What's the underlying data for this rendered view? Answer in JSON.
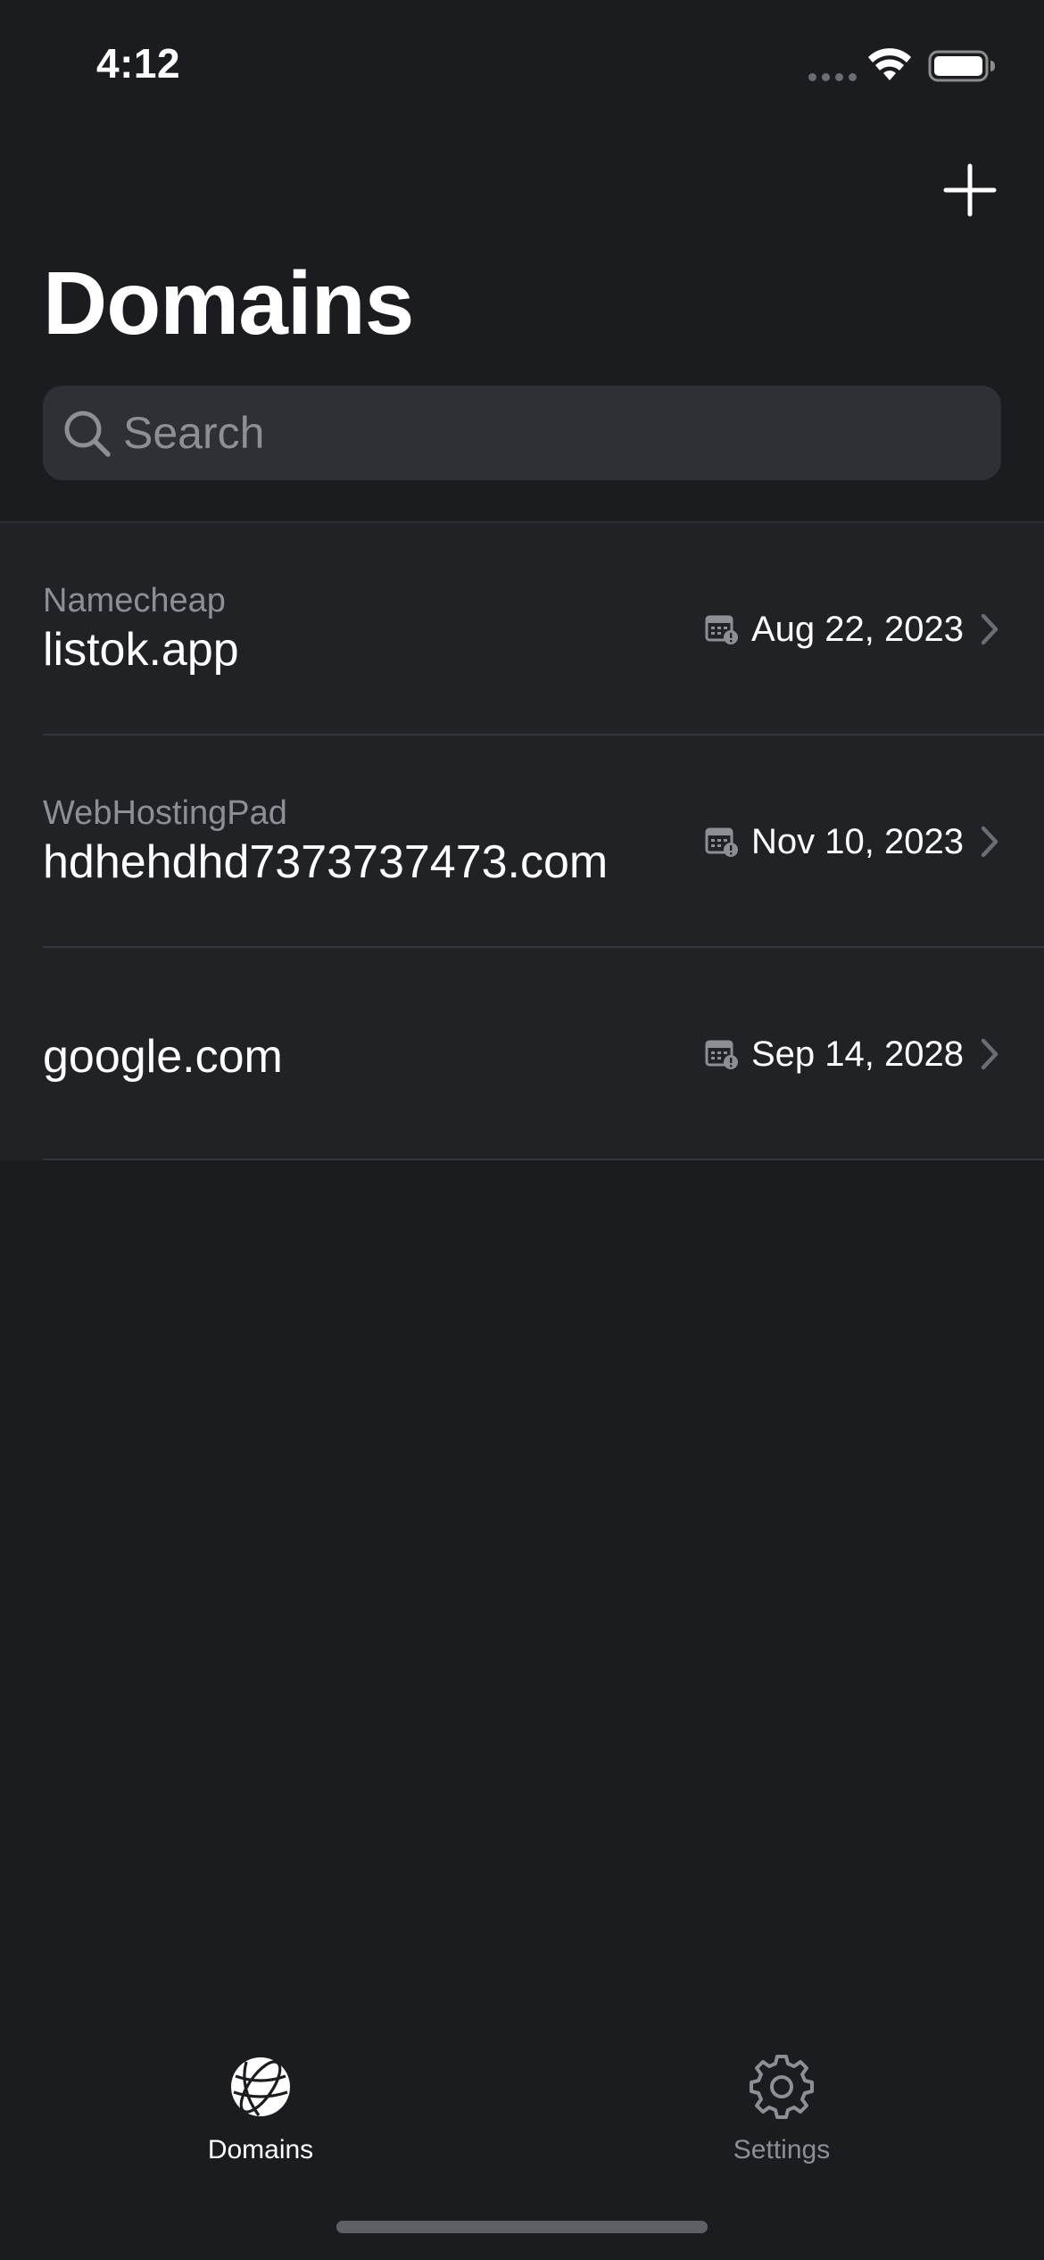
{
  "status_bar": {
    "time": "4:12",
    "icons": [
      "signal-dots-icon",
      "wifi-icon",
      "battery-icon"
    ]
  },
  "header": {
    "title": "Domains",
    "add_icon": "plus-icon"
  },
  "search": {
    "placeholder": "Search",
    "value": "",
    "icon": "magnifier-icon"
  },
  "domains": [
    {
      "registrar": "Namecheap",
      "name": "listok.app",
      "expiry": "Aug 22, 2023",
      "icon": "calendar-alert-icon"
    },
    {
      "registrar": "WebHostingPad",
      "name": "hdhehdhd7373737473.com",
      "expiry": "Nov 10, 2023",
      "icon": "calendar-alert-icon"
    },
    {
      "registrar": "",
      "name": "google.com",
      "expiry": "Sep 14, 2028",
      "icon": "calendar-alert-icon"
    }
  ],
  "tab_bar": {
    "tabs": [
      {
        "label": "Domains",
        "icon": "globe-icon",
        "active": true
      },
      {
        "label": "Settings",
        "icon": "gear-icon",
        "active": false
      }
    ]
  },
  "colors": {
    "background": "#1a1c1f",
    "list_background": "#202226",
    "search_background": "#2e3035",
    "secondary_text": "#8d8f94",
    "primary_text": "#ffffff"
  }
}
